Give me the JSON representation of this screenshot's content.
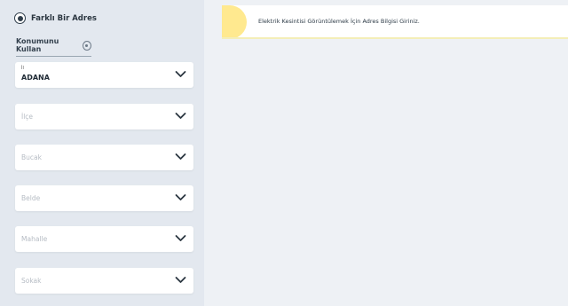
{
  "address_option": {
    "label": "Farklı Bir Adres",
    "selected": true
  },
  "use_location": {
    "label": "Konumunu Kullan"
  },
  "fields": {
    "il": {
      "label": "İl",
      "value": "ADANA"
    },
    "ilce": {
      "placeholder": "İlçe"
    },
    "bucak": {
      "placeholder": "Bucak"
    },
    "belde": {
      "placeholder": "Belde"
    },
    "mahalle": {
      "placeholder": "Mahalle"
    },
    "sokak": {
      "placeholder": "Sokak"
    }
  },
  "notice": {
    "text": "Elektrik Kesintisi Görüntülemek İçin Adres Bilgisi Giriniz."
  },
  "colors": {
    "sidebar_bg": "#e3e8ef",
    "main_bg": "#eef1f5",
    "notice_accent": "#ffe98f",
    "text_dark": "#2b3640"
  },
  "icons": {
    "radio": "radio-selected-icon",
    "locate": "location-target-icon",
    "chevron": "chevron-down-icon"
  }
}
